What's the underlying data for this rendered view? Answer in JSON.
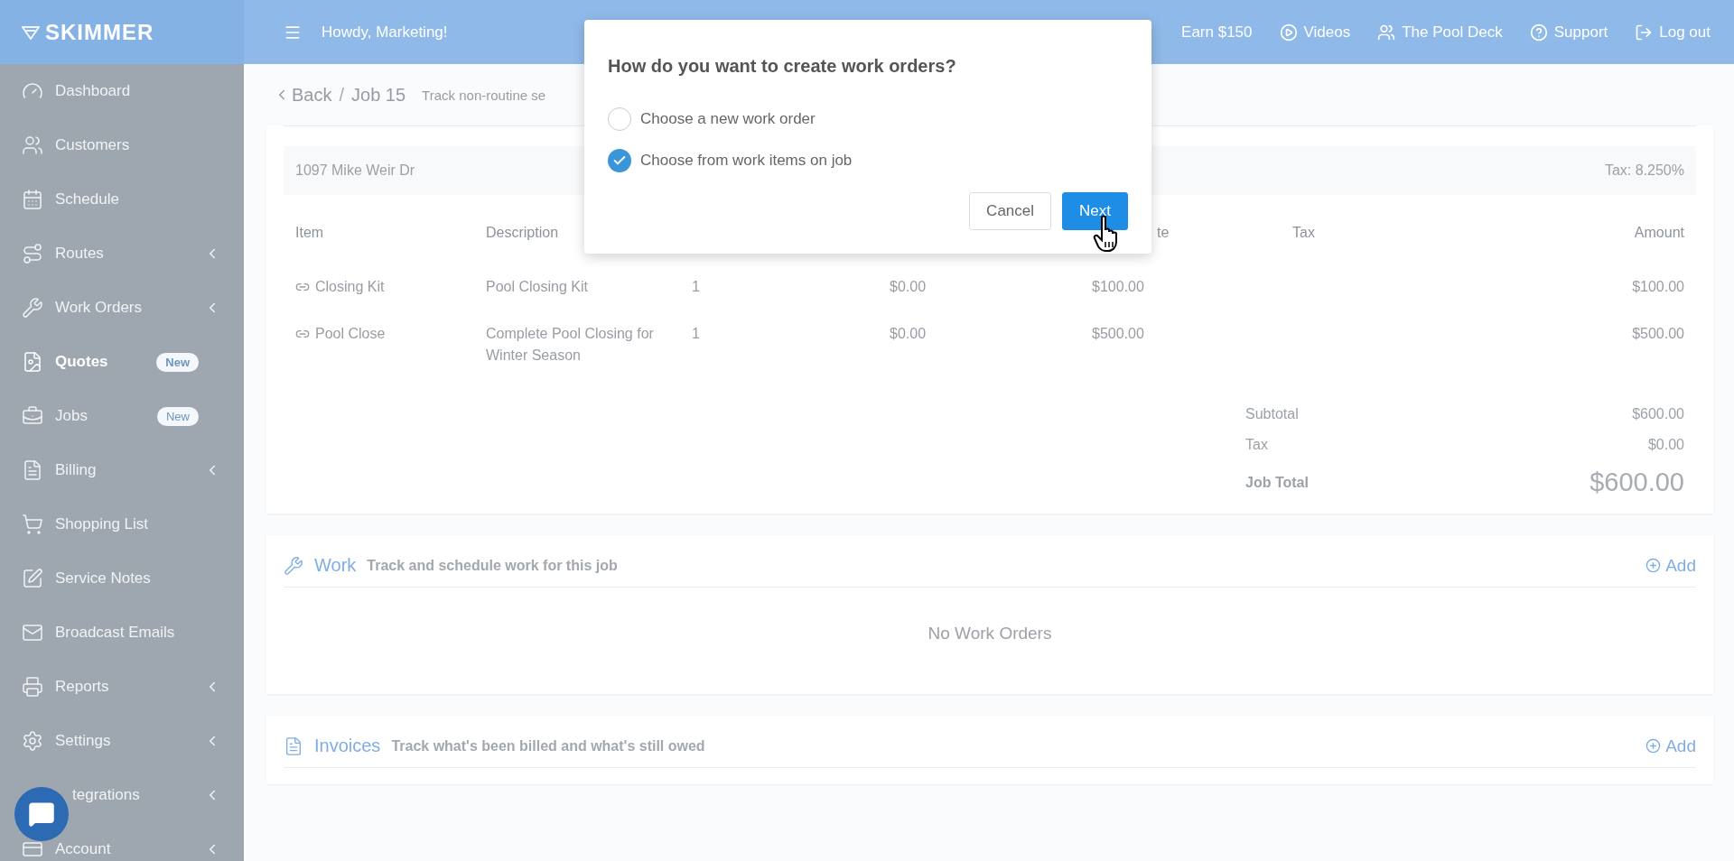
{
  "topbar": {
    "logo": "SKIMMER",
    "greeting": "Howdy, Marketing!",
    "links": [
      {
        "label": "Earn $150",
        "kind": "none"
      },
      {
        "label": "Videos",
        "kind": "play"
      },
      {
        "label": "The Pool Deck",
        "kind": "people"
      },
      {
        "label": "Support",
        "kind": "help"
      },
      {
        "label": "Log out",
        "kind": "logout"
      }
    ]
  },
  "sidebar": {
    "items": [
      {
        "label": "Dashboard",
        "submenu": false,
        "selected": false
      },
      {
        "label": "Customers",
        "submenu": false,
        "selected": false
      },
      {
        "label": "Schedule",
        "submenu": false,
        "selected": false
      },
      {
        "label": "Routes",
        "submenu": true,
        "selected": false
      },
      {
        "label": "Work Orders",
        "submenu": true,
        "selected": false
      },
      {
        "label": "Quotes",
        "submenu": false,
        "selected": true,
        "badge": "New"
      },
      {
        "label": "Jobs",
        "submenu": false,
        "selected": false,
        "badge": "New"
      },
      {
        "label": "Billing",
        "submenu": true,
        "selected": false
      },
      {
        "label": "Shopping List",
        "submenu": false,
        "selected": false
      },
      {
        "label": "Service Notes",
        "submenu": false,
        "selected": false
      },
      {
        "label": "Broadcast Emails",
        "submenu": false,
        "selected": false
      },
      {
        "label": "Reports",
        "submenu": true,
        "selected": false
      },
      {
        "label": "Settings",
        "submenu": true,
        "selected": false
      },
      {
        "label": "tegrations",
        "submenu": true,
        "selected": false
      },
      {
        "label": "Account",
        "submenu": true,
        "selected": false
      }
    ]
  },
  "breadcrumb": {
    "back": "Back",
    "separator": "/",
    "current": "Job 15",
    "subtitle": "Track non-routine se"
  },
  "quote": {
    "address": "1097 Mike Weir Dr",
    "tax_rate": "Tax: 8.250%",
    "columns": [
      "Item",
      "Description",
      "te",
      "Tax",
      "Amount"
    ],
    "rows": [
      {
        "item": "Closing Kit",
        "description": "Pool Closing Kit",
        "qty": "1",
        "cost": "$0.00",
        "rate": "$100.00",
        "amount": "$100.00"
      },
      {
        "item": "Pool Close",
        "description": "Complete Pool Closing for Winter Season",
        "qty": "1",
        "cost": "$0.00",
        "rate": "$500.00",
        "amount": "$500.00"
      }
    ],
    "totals": [
      {
        "label": "Subtotal",
        "value": "$600.00",
        "kind": "plain"
      },
      {
        "label": "Tax",
        "value": "$0.00",
        "kind": "plain"
      },
      {
        "label": "Job Total",
        "value": "$600.00",
        "kind": "grand"
      }
    ]
  },
  "sections": [
    {
      "title": "Work",
      "subtitle": "Track and schedule work for this job",
      "action": "Add",
      "empty": "No Work Orders"
    },
    {
      "title": "Invoices",
      "subtitle": "Track what's been billed and what's still owed",
      "action": "Add"
    }
  ],
  "dialog": {
    "title": "How do you want to create work orders?",
    "options": [
      {
        "label": "Choose a new work order",
        "selected": false
      },
      {
        "label": "Choose from work items on job",
        "selected": true
      }
    ],
    "buttons": [
      {
        "label": "Cancel",
        "kind": "secondary"
      },
      {
        "label": "Next",
        "kind": "primary"
      }
    ]
  }
}
